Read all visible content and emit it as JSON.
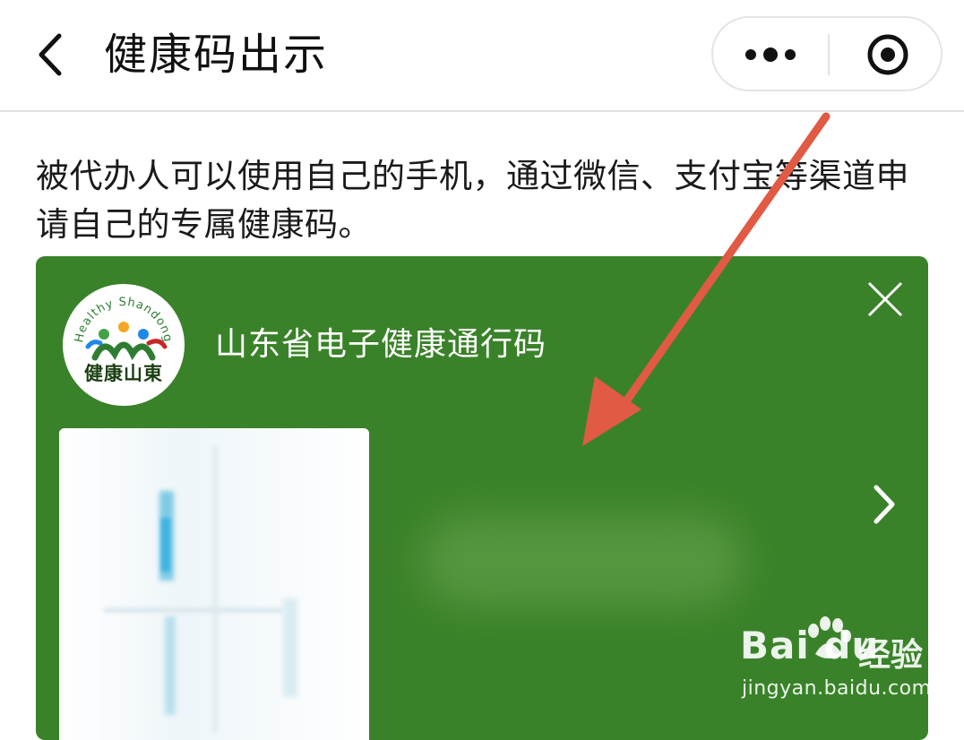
{
  "header": {
    "title": "健康码出示",
    "back_icon": "chevron-left-icon",
    "more_icon": "more-dots-icon",
    "close_icon": "target-circle-icon"
  },
  "intro": {
    "text": "被代办人可以使用自己的手机，通过微信、支付宝等渠道申请自己的专属健康码。"
  },
  "card": {
    "background": "#3a8229",
    "logo_arc_text": "Healthy Shandong",
    "logo_text": "健康山東",
    "title": "山东省电子健康通行码",
    "close_icon": "close-x-icon",
    "next_icon": "chevron-right-icon",
    "qr_icon": "health-qr-code-blurred"
  },
  "annotation": {
    "color": "#e05a44",
    "icon": "red-arrow-icon"
  },
  "watermark": {
    "brand": "Baidu",
    "brand_display": "Bai du",
    "cn": "经验",
    "url": "jingyan.baidu.com"
  }
}
